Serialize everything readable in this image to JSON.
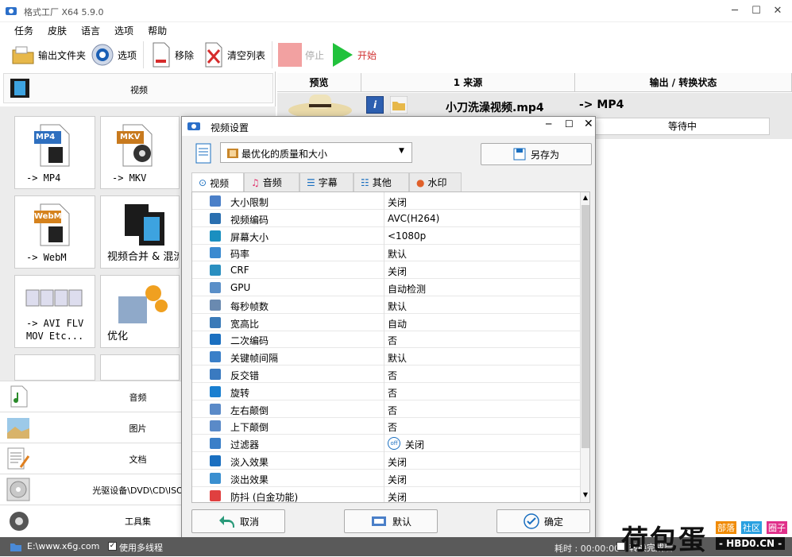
{
  "window": {
    "title": "格式工厂 X64 5.9.0",
    "min": "─",
    "max": "☐",
    "close": "✕"
  },
  "menu": [
    "任务",
    "皮肤",
    "语言",
    "选项",
    "帮助"
  ],
  "toolbar": {
    "output_folder": "输出文件夹",
    "options": "选项",
    "remove": "移除",
    "clear_list": "清空列表",
    "stop": "停止",
    "start": "开始"
  },
  "left": {
    "video_category": "视频",
    "tiles": [
      {
        "badge": "MP4",
        "label": "-> MP4"
      },
      {
        "badge": "MKV",
        "label": "-> MKV"
      },
      {
        "badge": "WebM",
        "label": "-> WebM"
      },
      {
        "badge": "",
        "label": "视频合并 & 混流"
      },
      {
        "badge": "",
        "label": "-> AVI FLV\nMOV Etc..."
      },
      {
        "badge": "",
        "label": "优化"
      }
    ],
    "categories": [
      "音频",
      "图片",
      "文档",
      "光驱设备\\DVD\\CD\\ISO",
      "工具集"
    ]
  },
  "table": {
    "headers": [
      "预览",
      "1 来源",
      "输出 / 转换状态"
    ],
    "row": {
      "source": "小刀洗澡视频.mp4",
      "output": "-> MP4",
      "status": "等待中"
    }
  },
  "dialog": {
    "title": "视频设置",
    "preset": "最优化的质量和大小",
    "save_as": "另存为",
    "tabs": [
      "视频",
      "音频",
      "字幕",
      "其他",
      "水印"
    ],
    "props": [
      {
        "name": "大小限制",
        "value": "关闭",
        "icon": "ruler-icon"
      },
      {
        "name": "视频编码",
        "value": "AVC(H264)",
        "icon": "film-icon"
      },
      {
        "name": "屏幕大小",
        "value": "<1080p",
        "icon": "monitor-icon"
      },
      {
        "name": "码率",
        "value": "默认",
        "icon": "wave-icon"
      },
      {
        "name": "CRF",
        "value": "关闭",
        "icon": "gear-icon"
      },
      {
        "name": "GPU",
        "value": "自动检测",
        "icon": "gpu-icon"
      },
      {
        "name": "每秒帧数",
        "value": "默认",
        "icon": "fps-icon"
      },
      {
        "name": "宽高比",
        "value": "自动",
        "icon": "aspect-icon"
      },
      {
        "name": "二次编码",
        "value": "否",
        "icon": "two-pass-icon"
      },
      {
        "name": "关键帧间隔",
        "value": "默认",
        "icon": "keyframe-icon"
      },
      {
        "name": "反交错",
        "value": "否",
        "icon": "deinterlace-icon"
      },
      {
        "name": "旋转",
        "value": "否",
        "icon": "rotate-icon"
      },
      {
        "name": "左右颠倒",
        "value": "否",
        "icon": "flip-h-icon"
      },
      {
        "name": "上下颠倒",
        "value": "否",
        "icon": "flip-v-icon"
      },
      {
        "name": "过滤器",
        "value": "关闭",
        "icon": "filter-icon",
        "badge": "off"
      },
      {
        "name": "淡入效果",
        "value": "关闭",
        "icon": "fade-in-icon"
      },
      {
        "name": "淡出效果",
        "value": "关闭",
        "icon": "fade-out-icon"
      },
      {
        "name": "防抖 (白金功能)",
        "value": "关闭",
        "icon": "stabilize-icon"
      }
    ],
    "cancel": "取消",
    "default": "默认",
    "ok": "确定"
  },
  "status": {
    "path": "E:\\www.x6g.com",
    "multithread": "使用多线程",
    "elapsed": "耗时 : 00:00:00",
    "after_done": "转换完成后"
  },
  "watermark": {
    "main": "荷包蛋",
    "tags": [
      "部落",
      "社区",
      "圈子"
    ],
    "site": "- HBD0.CN -"
  },
  "colors": {
    "accent": "#1e90ff",
    "start_green": "#21c23c",
    "stop_red": "#f2a1a1"
  }
}
